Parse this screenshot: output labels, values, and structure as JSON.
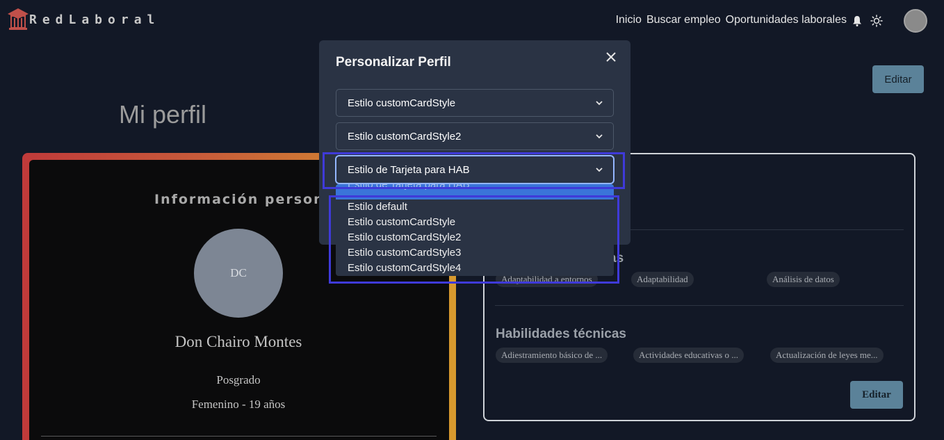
{
  "header": {
    "brand": "RedLaboral",
    "nav": [
      "Inicio",
      "Buscar empleo",
      "Oportunidades laborales"
    ]
  },
  "page": {
    "title": "Mi perfil",
    "edit_label": "Editar"
  },
  "personal": {
    "section_title": "Información personal",
    "initials": "DC",
    "name": "Don Chairo Montes",
    "education": "Posgrado",
    "gender_age": "Femenino - 19 años"
  },
  "skills": {
    "soft_title_visible": "as",
    "soft_chips": [
      "Adaptabilidad a entornos",
      "Adaptabilidad",
      "Análisis de datos"
    ],
    "tech_title": "Habilidades técnicas",
    "tech_chips": [
      "Adiestramiento básico de ...",
      "Actividades educativas o ...",
      "Actualización de leyes me..."
    ],
    "edit_label": "Editar"
  },
  "modal": {
    "title": "Personalizar Perfil",
    "select1": "Estilo customCardStyle",
    "select2": "Estilo customCardStyle2",
    "select3": "Estilo de Tarjeta para HAB",
    "dropdown_options": [
      "Estilo de Tarjeta para HAB",
      "Estilo default",
      "Estilo customCardStyle",
      "Estilo customCardStyle2",
      "Estilo customCardStyle3",
      "Estilo customCardStyle4"
    ]
  },
  "colors": {
    "background": "#121826",
    "modal": "#2a3344",
    "accent_button": "#5b8299",
    "highlight": "#3f3ad9",
    "dropdown_selected": "#3a74d9"
  },
  "icons": [
    "logo-icon",
    "bell-icon",
    "sun-icon",
    "close-icon",
    "chevron-down-icon"
  ]
}
